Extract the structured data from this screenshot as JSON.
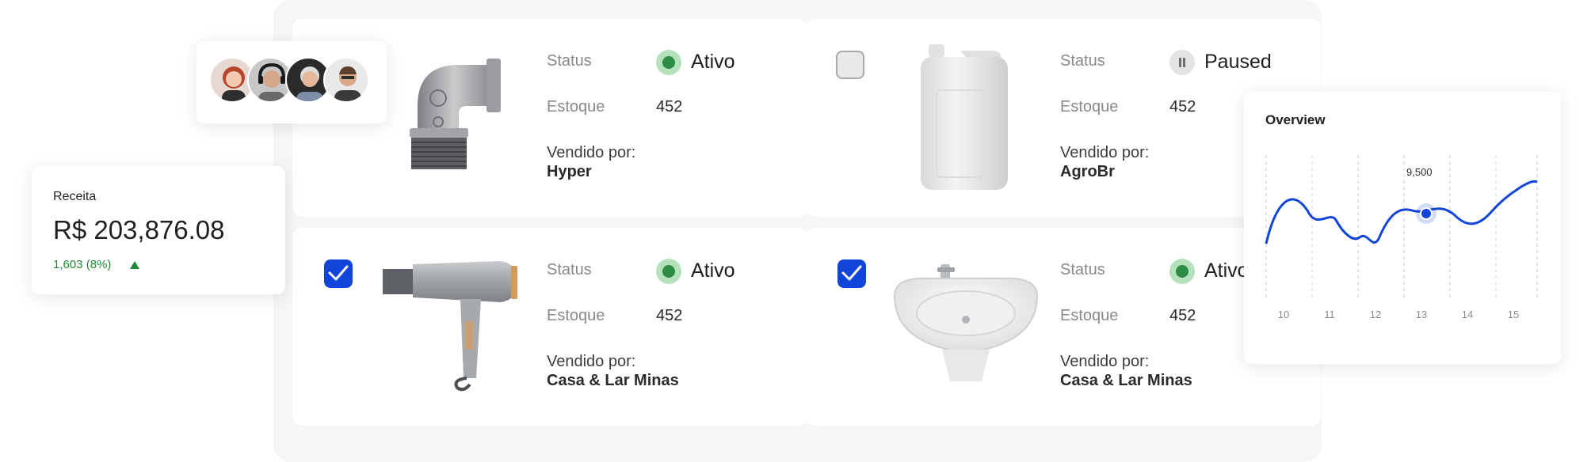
{
  "products": [
    {
      "checked": null,
      "image": "pipe-elbow-image",
      "status_label": "Status",
      "status_value": "Ativo",
      "status_kind": "active",
      "stock_label": "Estoque",
      "stock_value": "452",
      "vendor_label": "Vendido por:",
      "vendor_name": "Hyper"
    },
    {
      "checked": false,
      "image": "jerrycan-image",
      "status_label": "Status",
      "status_value": "Paused",
      "status_kind": "paused",
      "stock_label": "Estoque",
      "stock_value": "452",
      "vendor_label": "Vendido por:",
      "vendor_name": "AgroBr"
    },
    {
      "checked": true,
      "image": "hair-dryer-image",
      "status_label": "Status",
      "status_value": "Ativo",
      "status_kind": "active",
      "stock_label": "Estoque",
      "stock_value": "452",
      "vendor_label": "Vendido por:",
      "vendor_name": "Casa & Lar Minas"
    },
    {
      "checked": true,
      "image": "sink-image",
      "status_label": "Status",
      "status_value": "Ativo",
      "status_kind": "active",
      "stock_label": "Estoque",
      "stock_value": "452",
      "vendor_label": "Vendido por:",
      "vendor_name": "Casa & Lar Minas"
    }
  ],
  "revenue": {
    "title": "Receita",
    "value": "R$ 203,876.08",
    "change": "1,603 (8%)",
    "trend": "up"
  },
  "avatars": [
    "avatar-woman-red-hair",
    "avatar-man-headphones",
    "avatar-man-gray-hair",
    "avatar-man-glasses"
  ],
  "overview": {
    "title": "Overview",
    "highlight_label": "9,500",
    "ticks": [
      "10",
      "11",
      "12",
      "13",
      "14",
      "15"
    ]
  },
  "colors": {
    "accent": "#1144d9",
    "success": "#2e8d45",
    "panel": "#f6f6f6"
  }
}
